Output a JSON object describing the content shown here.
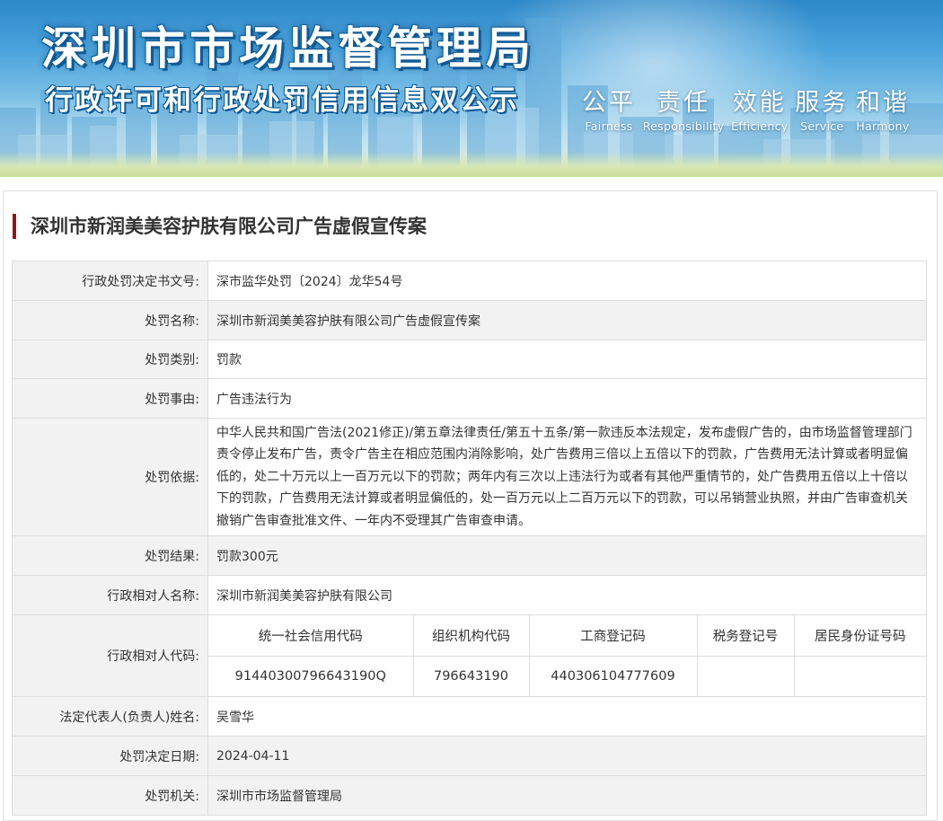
{
  "header": {
    "title": "深圳市市场监督管理局",
    "subtitle": "行政许可和行政处罚信用信息双公示",
    "motto": [
      {
        "cn": "公平",
        "en": "Fairness"
      },
      {
        "cn": "责任",
        "en": "Responsibility"
      },
      {
        "cn": "效能",
        "en": "Efficiency"
      },
      {
        "cn": "服务",
        "en": "Service"
      },
      {
        "cn": "和谐",
        "en": "Harmony"
      }
    ]
  },
  "case": {
    "title": "深圳市新润美美容护肤有限公司广告虚假宣传案",
    "rows": {
      "doc_no": {
        "label": "行政处罚决定书文号:",
        "value": "深市监华处罚〔2024〕龙华54号"
      },
      "name": {
        "label": "处罚名称:",
        "value": "深圳市新润美美容护肤有限公司广告虚假宣传案"
      },
      "category": {
        "label": "处罚类别:",
        "value": "罚款"
      },
      "reason": {
        "label": "处罚事由:",
        "value": "广告违法行为"
      },
      "basis": {
        "label": "处罚依据:",
        "value": "中华人民共和国广告法(2021修正)/第五章法律责任/第五十五条/第一款违反本法规定，发布虚假广告的，由市场监督管理部门责令停止发布广告，责令广告主在相应范围内消除影响，处广告费用三倍以上五倍以下的罚款，广告费用无法计算或者明显偏低的，处二十万元以上一百万元以下的罚款；两年内有三次以上违法行为或者有其他严重情节的，处广告费用五倍以上十倍以下的罚款，广告费用无法计算或者明显偏低的，处一百万元以上二百万元以下的罚款，可以吊销营业执照，并由广告审查机关撤销广告审查批准文件、一年内不受理其广告审查申请。"
      },
      "result": {
        "label": "处罚结果:",
        "value": "罚款300元"
      },
      "party_name": {
        "label": "行政相对人名称:",
        "value": "深圳市新润美美容护肤有限公司"
      },
      "party_code": {
        "label": "行政相对人代码:",
        "headers": [
          "统一社会信用代码",
          "组织机构代码",
          "工商登记码",
          "税务登记号",
          "居民身份证号码"
        ],
        "values": [
          "91440300796643190Q",
          "796643190",
          "440306104777609",
          "",
          ""
        ]
      },
      "legal_rep": {
        "label": "法定代表人(负责人)姓名:",
        "value": "吴雪华"
      },
      "date": {
        "label": "处罚决定日期:",
        "value": "2024-04-11"
      },
      "authority": {
        "label": "处罚机关:",
        "value": "深圳市市场监督管理局"
      }
    }
  }
}
